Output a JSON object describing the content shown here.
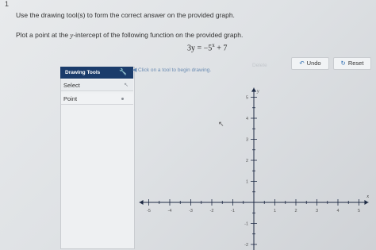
{
  "question_number": "1",
  "instruction": "Use the drawing tool(s) to form the correct answer on the provided graph.",
  "prompt": {
    "before": "Plot a point at the ",
    "variable": "y",
    "after": "-intercept of the following function on the provided graph."
  },
  "equation": {
    "lhs": "3y",
    "eq": " = −5",
    "exponent": "x",
    "rest": " + 7"
  },
  "tools_panel": {
    "title": "Drawing Tools",
    "items": [
      {
        "label": "Select"
      },
      {
        "label": "Point"
      }
    ]
  },
  "hint": "Click on a tool to begin drawing.",
  "toolbar": {
    "delete_label": "Delete",
    "undo_label": "Undo",
    "reset_label": "Reset"
  },
  "graph": {
    "x_ticks": [
      "-5",
      "-4",
      "-3",
      "-2",
      "-1",
      "1",
      "2",
      "3",
      "4",
      "5"
    ],
    "y_ticks": [
      "5",
      "4",
      "3",
      "2",
      "1",
      "-1",
      "-2"
    ],
    "x_axis_label": "x",
    "y_axis_label": "y",
    "x_range": [
      -5,
      5
    ],
    "y_range": [
      -2,
      5
    ]
  },
  "colors": {
    "panel_header": "#1b3c6b",
    "accent": "#2f6fb3",
    "hint": "#6b8cb3"
  }
}
